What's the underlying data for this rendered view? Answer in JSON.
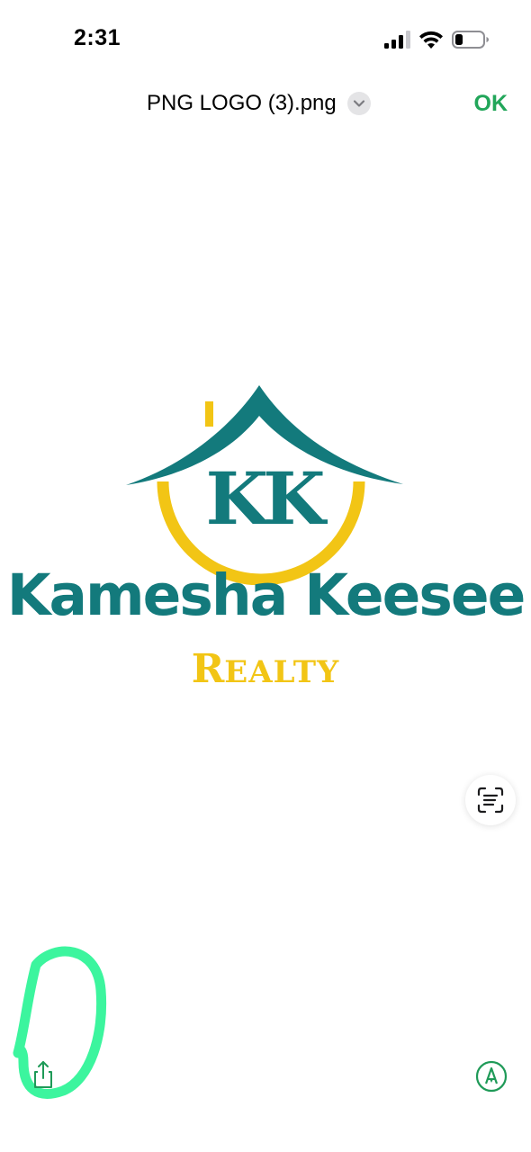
{
  "status_bar": {
    "time": "2:31",
    "icons": [
      "cellular-signal-icon",
      "wifi-icon",
      "battery-icon"
    ],
    "battery_level": 0.2
  },
  "nav": {
    "title": "PNG LOGO (3).png",
    "ok_label": "OK"
  },
  "logo": {
    "monogram": "KK",
    "name": "Kamesha Keesee",
    "subtitle_initial": "R",
    "subtitle_rest": "EALTY",
    "teal": "#137a7c",
    "gold": "#f2c515"
  },
  "toolbar": {
    "share_icon": "share-icon",
    "markup_icon": "markup-pen-icon",
    "live_text_icon": "live-text-icon"
  },
  "colors": {
    "accent": "#22a65a",
    "annotation": "#3cf59e"
  }
}
